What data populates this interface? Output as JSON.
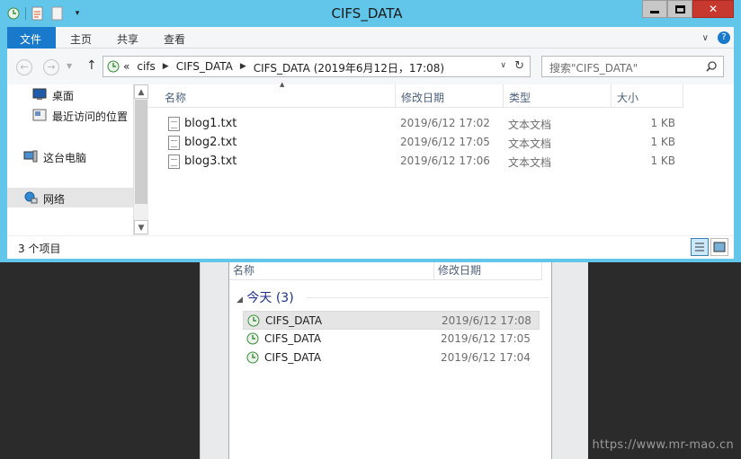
{
  "window": {
    "title": "CIFS_DATA",
    "minimize": "—",
    "maximize": "□",
    "close": "✕"
  },
  "ribbon": {
    "tabs": [
      {
        "label": "文件"
      },
      {
        "label": "主页"
      },
      {
        "label": "共享"
      },
      {
        "label": "查看"
      }
    ]
  },
  "address": {
    "prefix": "«",
    "crumbs": [
      "cifs",
      "CIFS_DATA",
      "CIFS_DATA (2019年6月12日，17:08)"
    ]
  },
  "search": {
    "placeholder": "搜索\"CIFS_DATA\""
  },
  "nav": {
    "items": [
      {
        "label": "桌面",
        "icon": "desktop-icon"
      },
      {
        "label": "最近访问的位置",
        "icon": "recent-places-icon"
      },
      {
        "label": "这台电脑",
        "icon": "computer-icon"
      },
      {
        "label": "网络",
        "icon": "network-icon"
      }
    ]
  },
  "files": {
    "columns": [
      "名称",
      "修改日期",
      "类型",
      "大小"
    ],
    "rows": [
      {
        "name": "blog1.txt",
        "date": "2019/6/12 17:02",
        "type": "文本文档",
        "size": "1 KB"
      },
      {
        "name": "blog2.txt",
        "date": "2019/6/12 17:05",
        "type": "文本文档",
        "size": "1 KB"
      },
      {
        "name": "blog3.txt",
        "date": "2019/6/12 17:06",
        "type": "文本文档",
        "size": "1 KB"
      }
    ]
  },
  "status": {
    "text": "3 个项目"
  },
  "background_dialog": {
    "columns": [
      "名称",
      "修改日期"
    ],
    "group": "今天 (3)",
    "rows": [
      {
        "name": "CIFS_DATA",
        "date": "2019/6/12 17:08"
      },
      {
        "name": "CIFS_DATA",
        "date": "2019/6/12 17:05"
      },
      {
        "name": "CIFS_DATA",
        "date": "2019/6/12 17:04"
      }
    ]
  },
  "watermark": "https://www.mr-mao.cn",
  "colors": {
    "title_bar": "#62c5ea",
    "file_tab": "#1979ca",
    "close_button": "#c7382f"
  }
}
